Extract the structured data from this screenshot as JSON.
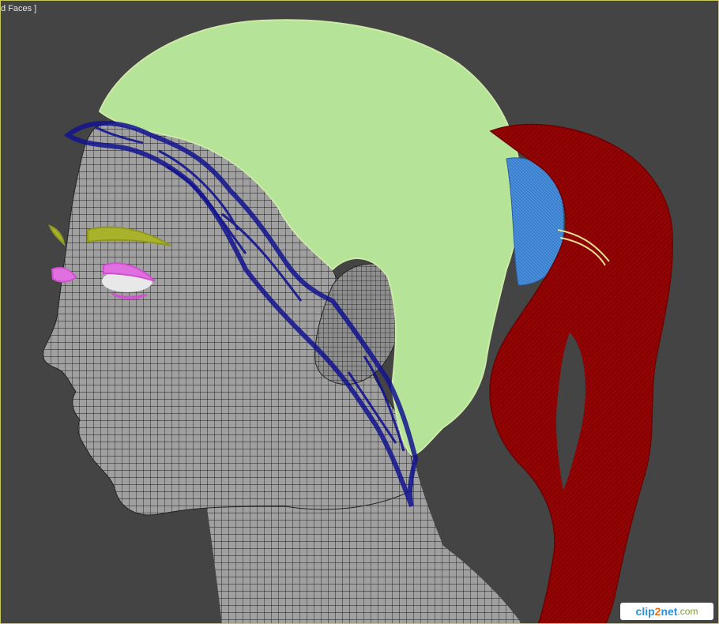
{
  "viewport": {
    "label": "d Faces ]",
    "border_color": "#c8c85a",
    "background_color": "#444444"
  },
  "scene": {
    "objects": [
      {
        "name": "head-mesh",
        "color": "#9a9a9a",
        "wire_color": "#1a1a1a"
      },
      {
        "name": "scalp-hair",
        "color": "#b5e397"
      },
      {
        "name": "hairline-strands",
        "color": "#13138f"
      },
      {
        "name": "ponytail",
        "color": "#8b0000"
      },
      {
        "name": "hair-tie",
        "color": "#3a7fd0"
      },
      {
        "name": "eyebrow",
        "color": "#a8b22a"
      },
      {
        "name": "eyelashes",
        "color": "#e070e0"
      }
    ]
  },
  "watermark": {
    "part1": "clip",
    "part2": "2",
    "part3": "net",
    "part4": ".com"
  }
}
